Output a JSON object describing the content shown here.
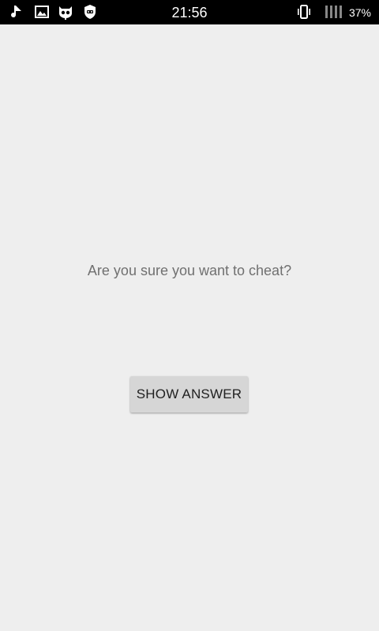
{
  "status_bar": {
    "time": "21:56",
    "battery": "37%",
    "left_icons": [
      "notification-app-icon",
      "gallery-icon",
      "cyanogenmod-icon",
      "shield-icon"
    ],
    "right_icons": [
      "vibrate-icon",
      "no-signal-icon"
    ]
  },
  "main": {
    "prompt": "Are you sure you want to cheat?",
    "show_answer_label": "SHOW ANSWER"
  },
  "colors": {
    "background": "#eeeeee",
    "status_bar": "#000000",
    "button": "#d6d6d6",
    "prompt_text": "#707070"
  }
}
